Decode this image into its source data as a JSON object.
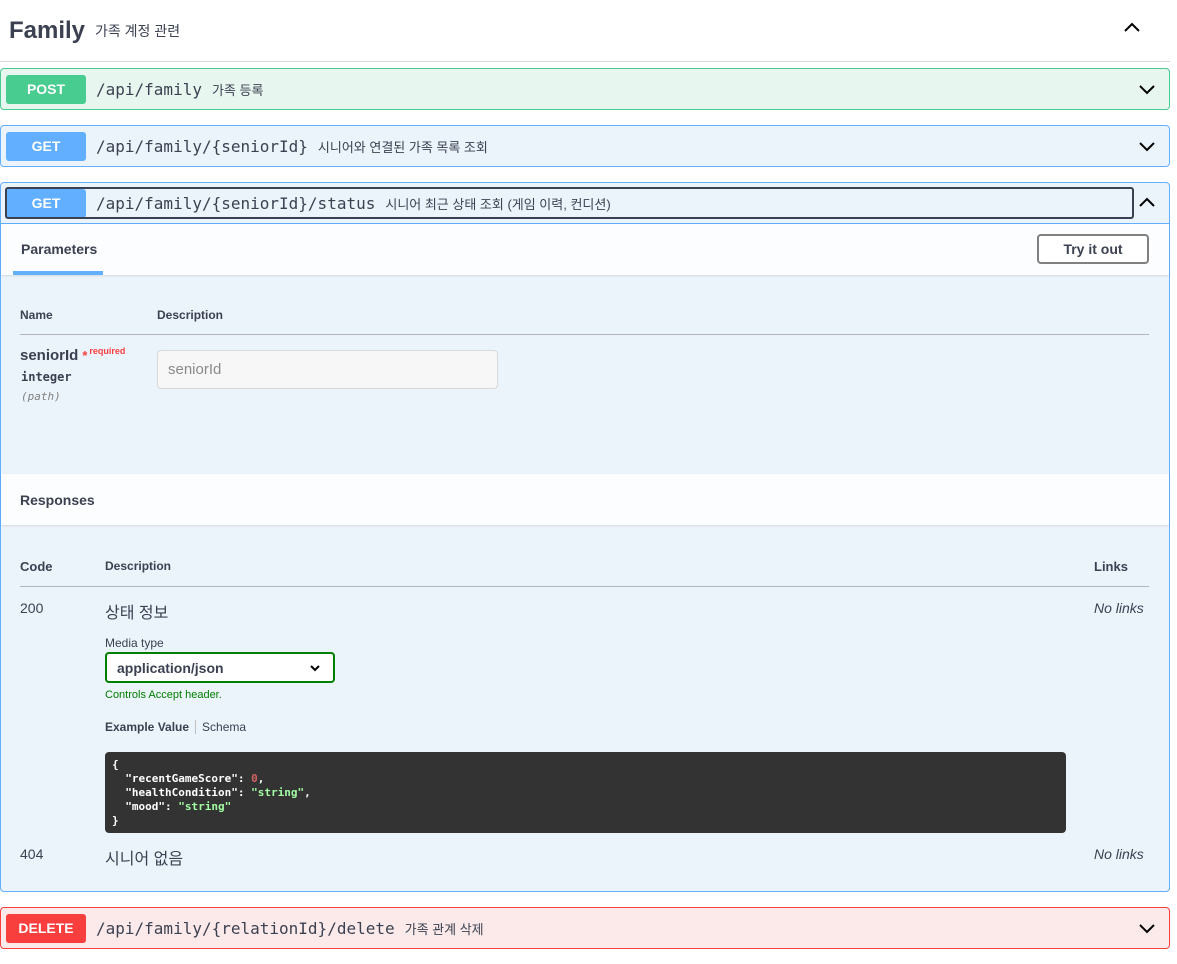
{
  "tag": {
    "title": "Family",
    "description": "가족 계정 관련",
    "toggle_icon": "chevron-up-icon"
  },
  "colors": {
    "post": "#49cc90",
    "get": "#61affe",
    "delete": "#f93e3e",
    "success_green": "#008000"
  },
  "operations": [
    {
      "method": "POST",
      "path": "/api/family",
      "summary": "가족 등록",
      "expanded": false
    },
    {
      "method": "GET",
      "path": "/api/family/{seniorId}",
      "summary": "시니어와 연결된 가족 목록 조회",
      "expanded": false
    },
    {
      "method": "GET",
      "path": "/api/family/{seniorId}/status",
      "summary": "시니어 최근 상태 조회 (게임 이력, 컨디션)",
      "expanded": true
    },
    {
      "method": "DELETE",
      "path": "/api/family/{relationId}/delete",
      "summary": "가족 관계 삭제",
      "expanded": false
    }
  ],
  "detail": {
    "parameters_tab": "Parameters",
    "try_button": "Try it out",
    "param_columns": {
      "name": "Name",
      "description": "Description"
    },
    "param": {
      "name": "seniorId",
      "star": "*",
      "required": "required",
      "type": "integer",
      "in": "(path)",
      "placeholder": "seniorId"
    },
    "responses_title": "Responses",
    "resp_columns": {
      "code": "Code",
      "description": "Description",
      "links": "Links"
    },
    "responses": [
      {
        "code": "200",
        "description": "상태 정보",
        "links": "No links",
        "media_type_label": "Media type",
        "media_type": "application/json",
        "accept_note": "Controls Accept header.",
        "example_tab": "Example Value",
        "schema_tab": "Schema",
        "example": {
          "open": "{",
          "line1_key": "  \"recentGameScore\"",
          "line1_val": "0",
          "line2_key": "  \"healthCondition\"",
          "line2_val": "\"string\"",
          "line3_key": "  \"mood\"",
          "line3_val": "\"string\"",
          "close": "}"
        }
      },
      {
        "code": "404",
        "description": "시니어 없음",
        "links": "No links"
      }
    ]
  }
}
